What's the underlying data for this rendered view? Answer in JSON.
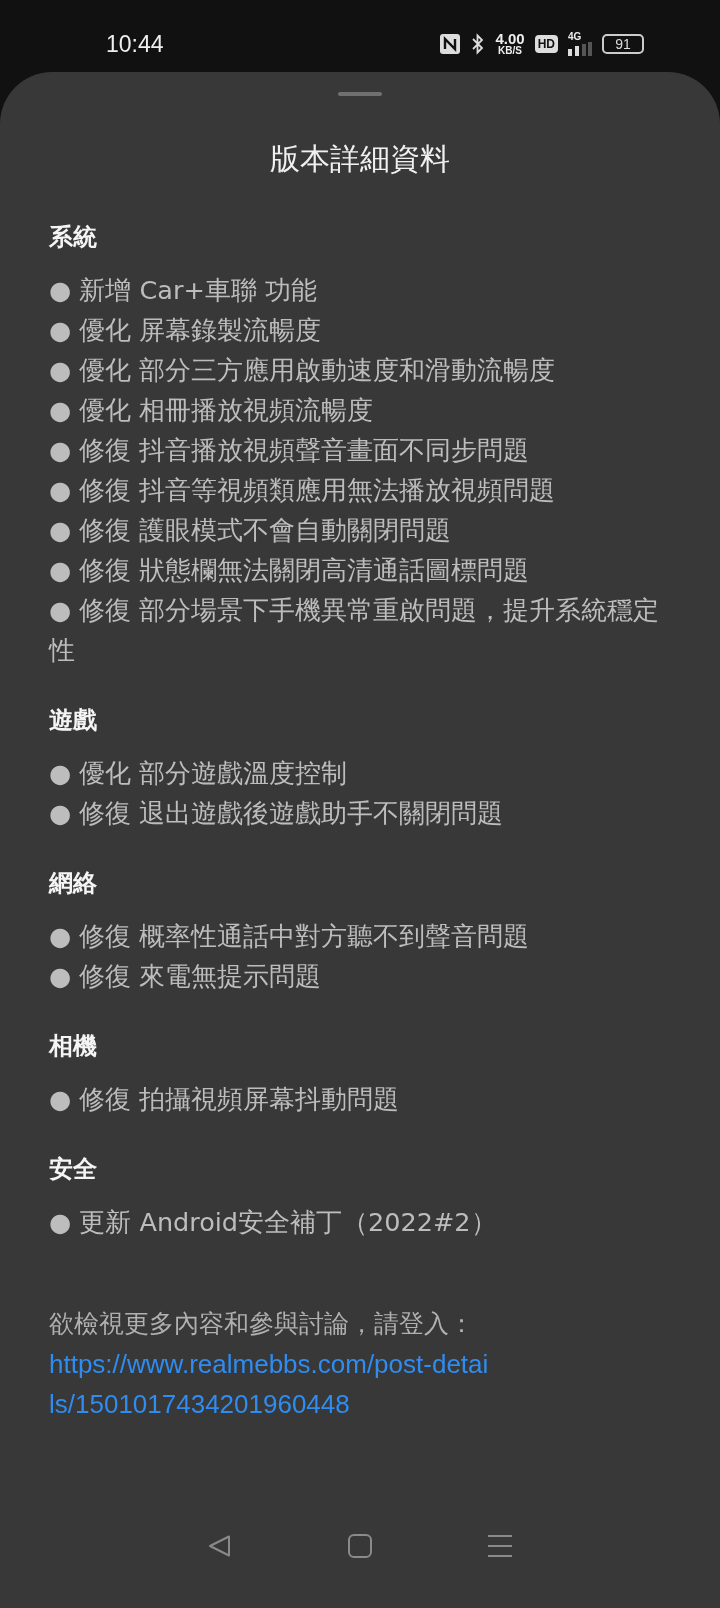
{
  "status_bar": {
    "time": "10:44",
    "speed": "4.00",
    "speed_unit": "KB/S",
    "hd": "HD",
    "network": "4G",
    "battery": "91"
  },
  "sheet": {
    "title": "版本詳細資料",
    "sections": [
      {
        "heading": "系統",
        "items": [
          "● 新增 Car+車聯 功能",
          "● 優化 屏幕錄製流暢度",
          "● 優化 部分三方應用啟動速度和滑動流暢度",
          "● 優化 相冊播放視頻流暢度",
          "● 修復 抖音播放視頻聲音畫面不同步問題",
          "● 修復 抖音等視頻類應用無法播放視頻問題",
          "● 修復 護眼模式不會自動關閉問題",
          "● 修復 狀態欄無法關閉高清通話圖標問題",
          "● 修復 部分場景下手機異常重啟問題，提升系統穩定性"
        ]
      },
      {
        "heading": "遊戲",
        "items": [
          "● 優化 部分遊戲溫度控制",
          "● 修復 退出遊戲後遊戲助手不關閉問題"
        ]
      },
      {
        "heading": "網絡",
        "items": [
          "● 修復 概率性通話中對方聽不到聲音問題",
          "● 修復 來電無提示問題"
        ]
      },
      {
        "heading": "相機",
        "items": [
          "● 修復 拍攝視頻屏幕抖動問題"
        ]
      },
      {
        "heading": "安全",
        "items": [
          "● 更新 Android安全補丁（2022#2）"
        ]
      }
    ],
    "note": "欲檢視更多內容和參與討論，請登入：",
    "link": "https://www.realmebbs.com/post-details/1501017434201960448"
  }
}
